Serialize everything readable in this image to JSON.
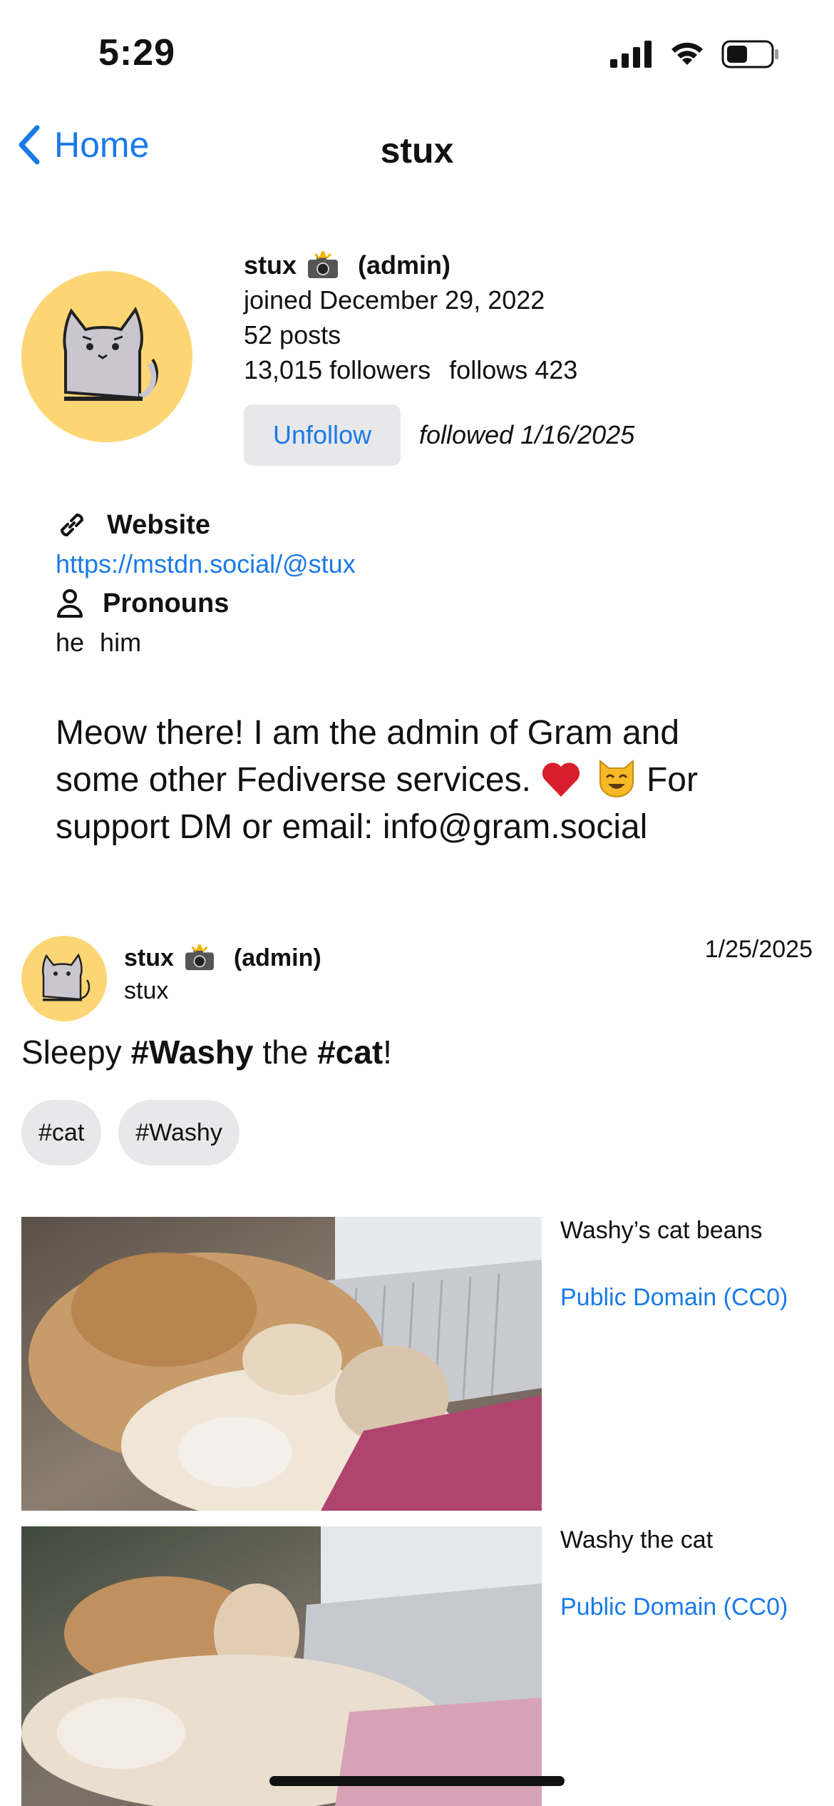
{
  "status_bar": {
    "time": "5:29"
  },
  "nav": {
    "back_label": "Home",
    "title": "stux"
  },
  "profile": {
    "display_name": "stux",
    "role": "(admin)",
    "joined": "joined December 29, 2022",
    "posts": "52 posts",
    "followers": "13,015 followers",
    "follows": "follows 423",
    "unfollow_label": "Unfollow",
    "followed_date": "followed 1/16/2025"
  },
  "fields": {
    "website_label": "Website",
    "website_url": "https://mstdn.social/@stux",
    "pronouns_label": "Pronouns",
    "pronoun_1": "he",
    "pronoun_2": "him"
  },
  "bio": {
    "line1": "Meow there! I am the admin of Gram and",
    "line2_start": "some other Fediverse services.",
    "line2_end": " For",
    "line3": "support DM or email: info@gram.social"
  },
  "post": {
    "author_name": "stux",
    "author_role": "(admin)",
    "handle": "stux",
    "date": "1/25/2025",
    "text_1": "Sleepy ",
    "text_tag_1": "#Washy",
    "text_2": " the ",
    "text_tag_2": "#cat",
    "text_3": "!",
    "tags": [
      "#cat",
      "#Washy"
    ],
    "media": [
      {
        "caption": "Washy’s cat beans",
        "license": "Public Domain (CC0)"
      },
      {
        "caption": "Washy the cat",
        "license": "Public Domain (CC0)"
      }
    ]
  },
  "colors": {
    "accent": "#1a7ae8",
    "avatar_bg": "#fcd675",
    "chip_bg": "#e8e8ea"
  }
}
